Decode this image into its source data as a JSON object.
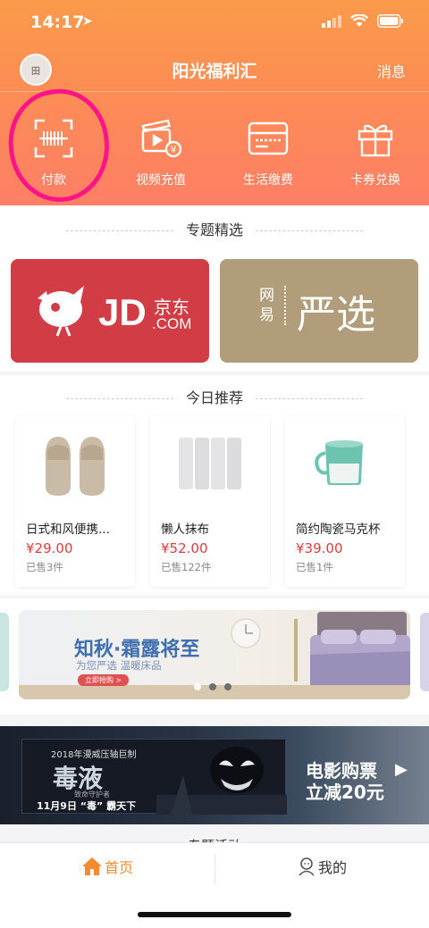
{
  "status": {
    "time": "14:17"
  },
  "header": {
    "title": "阳光福利汇",
    "messages": "消息",
    "avatar_text": "田"
  },
  "quick_actions": [
    {
      "label": "付款",
      "icon": "barcode-scan-icon"
    },
    {
      "label": "视频充值",
      "icon": "video-clapper-icon"
    },
    {
      "label": "生活缴费",
      "icon": "bank-card-icon"
    },
    {
      "label": "卡券兑换",
      "icon": "gift-icon"
    }
  ],
  "featured": {
    "title": "专题精选",
    "brands": [
      {
        "name": "JD.COM",
        "cn": "京东",
        "color": "#d23c44"
      },
      {
        "name": "严选",
        "cn_small": "网易",
        "color": "#b19d7a"
      }
    ]
  },
  "recommend": {
    "title": "今日推荐",
    "products": [
      {
        "name": "日式和风便携...",
        "price": "¥29.00",
        "sold": "已售3件"
      },
      {
        "name": "懒人抹布",
        "price": "¥52.00",
        "sold": "已售122件"
      },
      {
        "name": "简约陶瓷马克杯",
        "price": "¥39.00",
        "sold": "已售1件"
      }
    ]
  },
  "banner": {
    "headline": "知秋·霜露将至",
    "subline": "为您严选  温暖床品",
    "cta": "立即抢购 >"
  },
  "movie_banner": {
    "year_line": "2018年漫威压轴巨制",
    "film": "毒液",
    "film_sub": "致命守护者",
    "date_line": "11月9日 “毒” 霸天下",
    "promo_1": "电影购票",
    "promo_2": "立减20元"
  },
  "next_section": {
    "title": "专题活动"
  },
  "tabbar": {
    "home": "首页",
    "mine": "我的"
  },
  "colors": {
    "header_top": "#fb9a4a",
    "header_bottom": "#fe7f66",
    "accent": "#f58a2e",
    "price": "#e23c3c"
  }
}
